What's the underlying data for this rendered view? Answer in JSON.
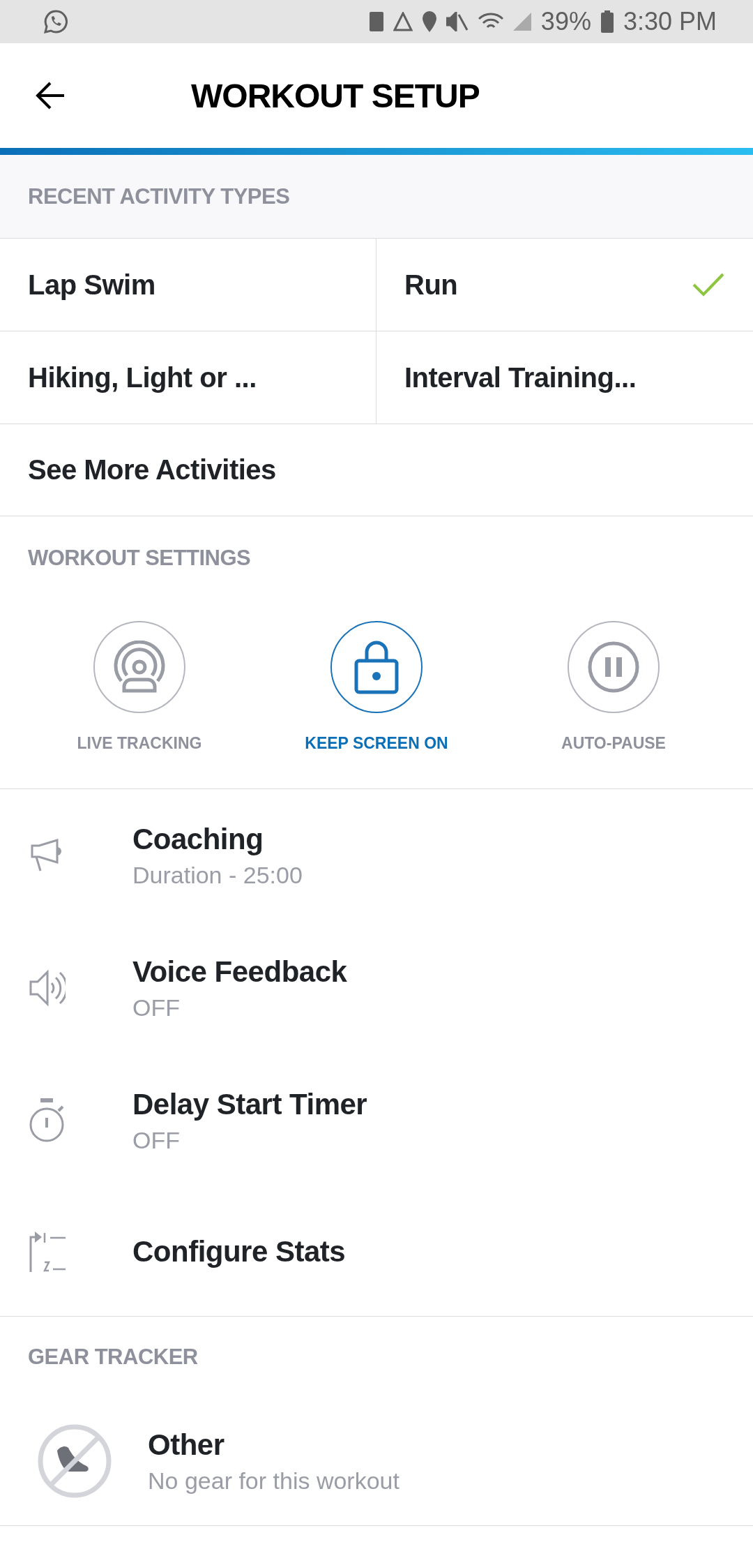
{
  "status_bar": {
    "battery": "39%",
    "time": "3:30 PM"
  },
  "header": {
    "title": "WORKOUT SETUP"
  },
  "recent_activity_types": {
    "heading": "RECENT ACTIVITY TYPES",
    "items": [
      {
        "label": "Lap Swim",
        "selected": false
      },
      {
        "label": "Run",
        "selected": true
      },
      {
        "label": "Hiking, Light or ...",
        "selected": false
      },
      {
        "label": "Interval Training...",
        "selected": false
      }
    ],
    "more": "See More Activities"
  },
  "workout_settings": {
    "heading": "WORKOUT SETTINGS",
    "toggles": [
      {
        "label": "LIVE TRACKING",
        "on": false
      },
      {
        "label": "KEEP SCREEN ON",
        "on": true
      },
      {
        "label": "AUTO-PAUSE",
        "on": false
      }
    ],
    "items": [
      {
        "title": "Coaching",
        "value": "Duration - 25:00"
      },
      {
        "title": "Voice Feedback",
        "value": "OFF"
      },
      {
        "title": "Delay Start Timer",
        "value": "OFF"
      },
      {
        "title": "Configure Stats"
      }
    ]
  },
  "gear_tracker": {
    "heading": "GEAR TRACKER",
    "item": {
      "title": "Other",
      "value": "No gear for this workout"
    }
  }
}
